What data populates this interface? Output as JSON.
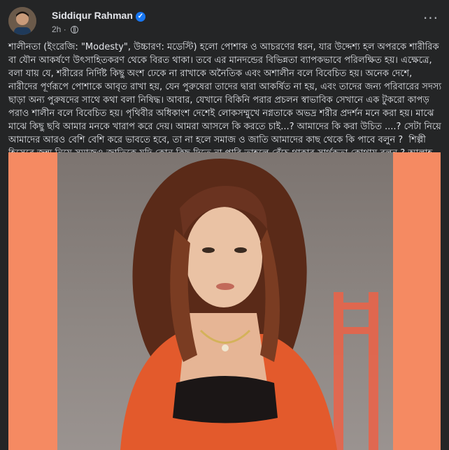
{
  "post": {
    "author": "Siddiqur Rahman",
    "time": "2h",
    "more_label": "···",
    "text": "শালীনতা (ইংরেজি: \"Modesty\", উচ্চারণ: মডেস্টি) হলো পোশাক ও আচরণের ধরন, যার উদ্দেশ্য হল অপরকে শারীরিক বা যৌন আকর্ষণে উৎসাহিতকরণ থেকে বিরত থাকা। তবে এর মানদন্ডের বিভিন্নতা ব্যাপকভাবে পরিলক্ষিত হয়। এক্ষেত্রে, বলা যায় যে, শরীরের নির্দিষ্ট কিছু অংশ ঢেকে না রাখাকে অনৈতিক এবং অশালীন বলে বিবেচিত হয়। অনেক দেশে, নারীদের পূর্ণরূপে পোশাকে আবৃত রাখা হয়, যেন পুরুষেরা তাদের দ্বারা আকর্ষিত না হয়, এবং তাদের জন্য পরিবারের সদস্য ছাড়া অন্য পুরুষদের সাথে কথা বলা নিষিদ্ধ। আবার, যেখানে বিকিনি পরার প্রচলন স্বাভাবিক সেখানে এক টুকরো কাপড় পরাও শালীন বলে বিবেচিত হয়। পৃথিবীর অধিকাংশ দেশেই লোকসম্মুখে নগ্নতাকে অভদ্র শরীর প্রদর্শন মনে করা হয়। মাঝে মাঝে কিছু ছবি আমার মনকে খারাপ করে দেয়। আমরা আসলে কি করতে চাই...? আমাদের কি করা উচিত ....? সেটা নিয়ে আমাদের আরও বেশি বেশি করে ভাবতে হবে, তা না হলে সমাজ ও জাতি আমাদের কাছ থেকে কি পাবে বলুন ?  শিল্পী হিসেবে জন্ম নিয়ে সমাজও জাতিকে যদি কোন কিছু দিতে না পারি তাহলে বেঁচে থাকার সার্থকতা কোথায় বলুন ? আল্লাহ পাক সবাইকে হেদায়েত করুন। আমীন....."
  },
  "colors": {
    "background": "#242526",
    "photo_border": "#f58a62",
    "verified": "#1877f2"
  },
  "icons": [
    "verified-badge-icon",
    "globe-icon",
    "more-options-icon"
  ]
}
